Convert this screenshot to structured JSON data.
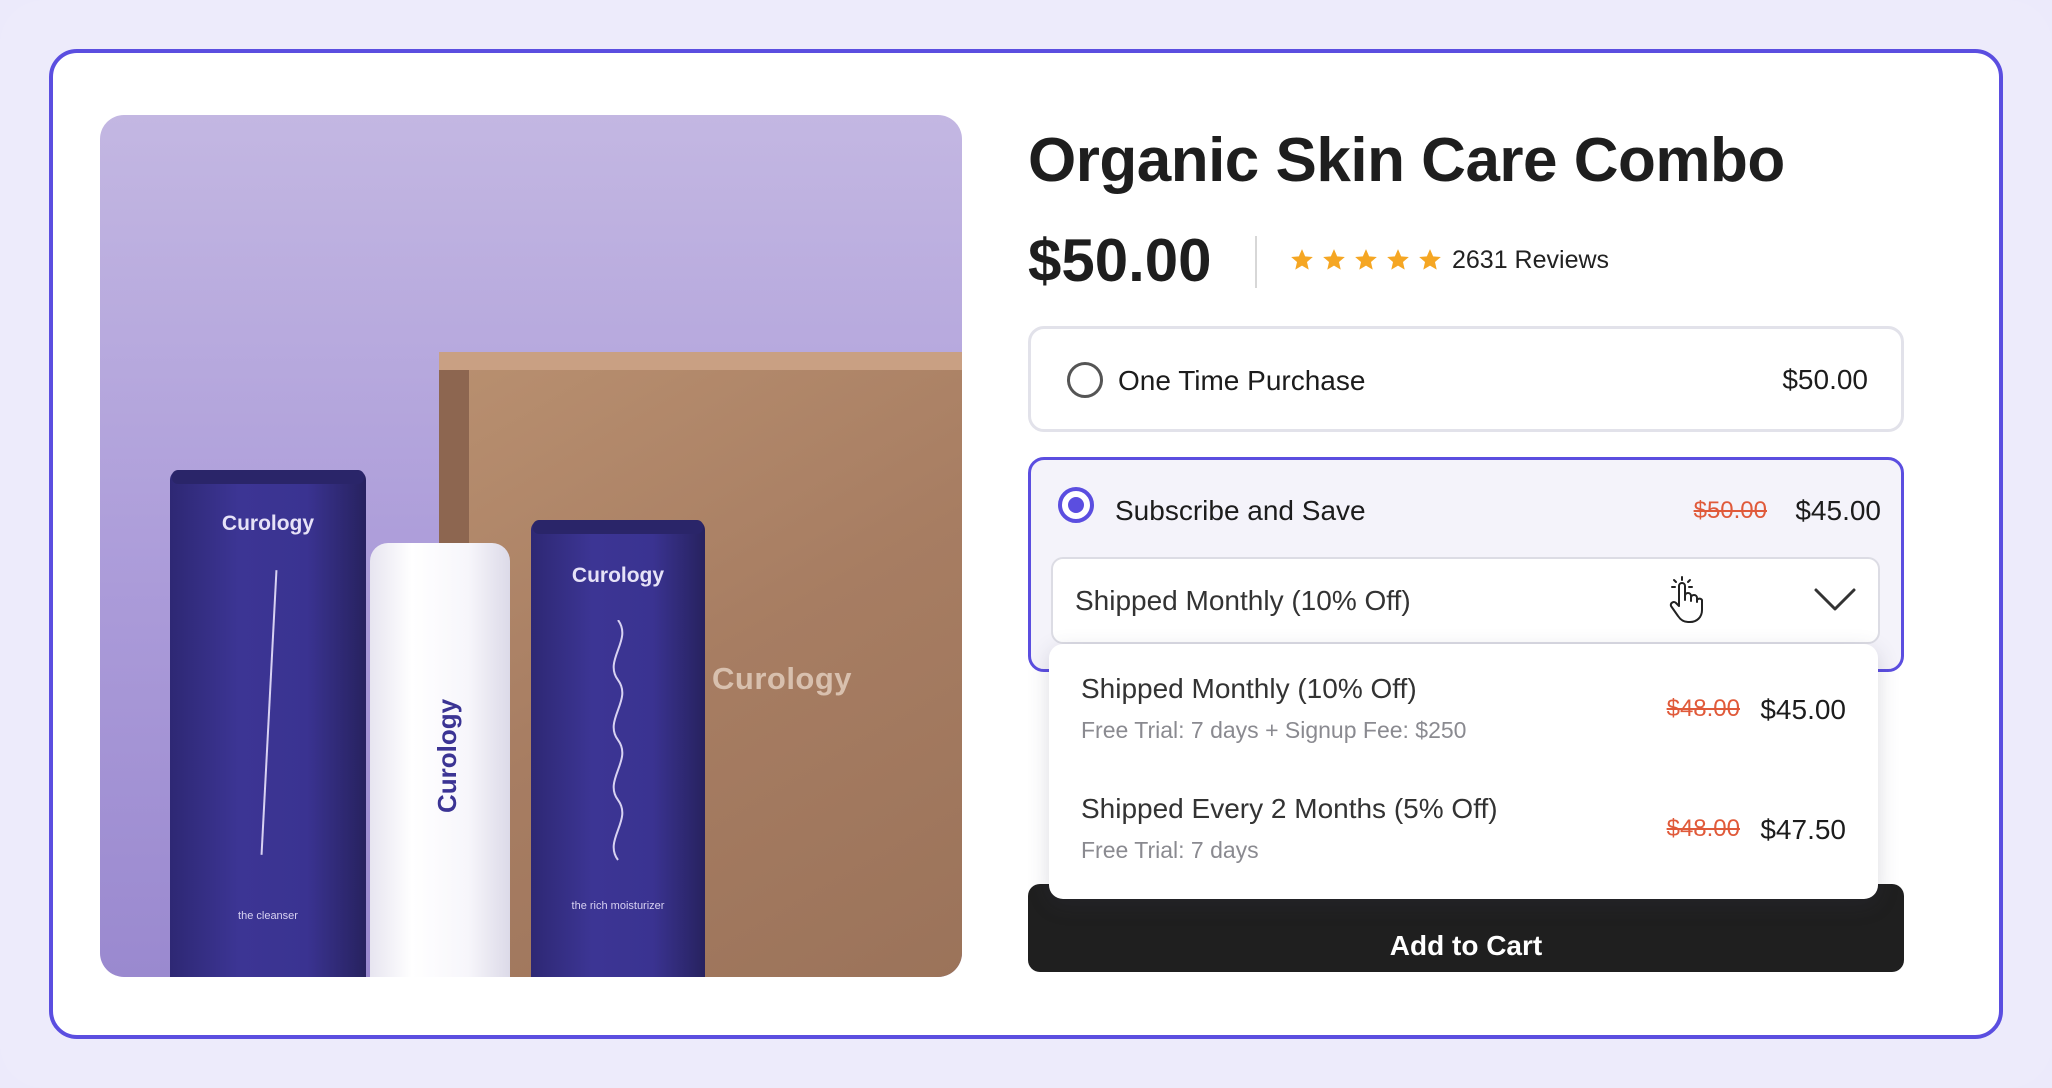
{
  "product": {
    "title": "Organic Skin Care Combo",
    "price": "$50.00",
    "rating": 5,
    "reviews": "2631 Reviews",
    "image_alt_brand": "Curology",
    "image_labels": {
      "tube_left": "Curology",
      "tube_left_sub": "the cleanser",
      "bottle": "Curology",
      "tube_right": "Curology",
      "tube_right_sub": "the rich moisturizer",
      "box": "Curology"
    }
  },
  "purchase_options": {
    "one_time": {
      "label": "One Time Purchase",
      "price": "$50.00",
      "selected": false
    },
    "subscribe": {
      "label": "Subscribe and Save",
      "old_price": "$50.00",
      "price": "$45.00",
      "selected": true,
      "frequency_selected": "Shipped Monthly (10% Off)"
    }
  },
  "frequency_dropdown": {
    "items": [
      {
        "title": "Shipped Monthly (10% Off)",
        "subtitle": "Free Trial: 7 days + Signup Fee: $250",
        "old_price": "$48.00",
        "price": "$45.00"
      },
      {
        "title": "Shipped Every 2 Months (5% Off)",
        "subtitle": "Free Trial: 7 days",
        "old_price": "$48.00",
        "price": "$47.50"
      }
    ]
  },
  "cart": {
    "add_label": "Add to Cart"
  },
  "colors": {
    "accent": "#5b4ee0",
    "star": "#f5a623",
    "strike": "#e05a3a",
    "button": "#1f1f1f",
    "background": "#edebfb"
  },
  "icons": [
    "star-icon",
    "radio-icon",
    "hand-pointer-icon",
    "chevron-down-icon"
  ]
}
